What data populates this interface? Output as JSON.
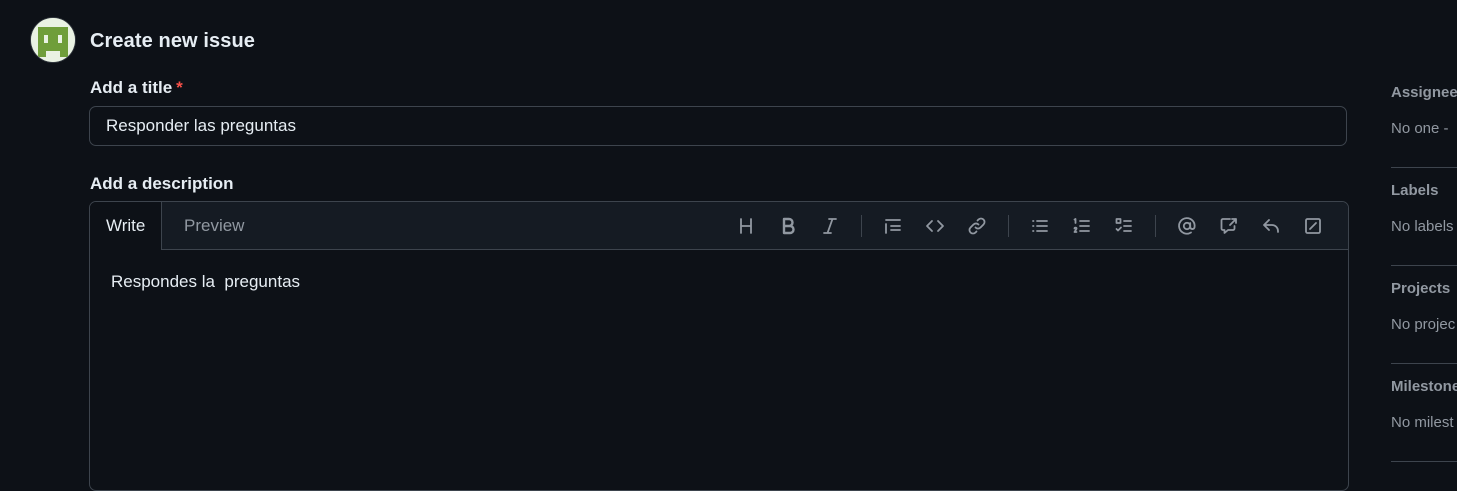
{
  "header": {
    "title": "Create new issue"
  },
  "form": {
    "title_label": "Add a title",
    "required_mark": "*",
    "title_value": "Responder las preguntas",
    "description_label": "Add a description",
    "tabs": {
      "write": "Write",
      "preview": "Preview"
    },
    "toolbar": {
      "buttons": [
        "heading-icon",
        "bold-icon",
        "italic-icon",
        "quote-icon",
        "code-icon",
        "link-icon",
        "unordered-list-icon",
        "ordered-list-icon",
        "task-list-icon",
        "mention-icon",
        "reference-icon",
        "saved-replies-icon",
        "slash-commands-icon"
      ]
    },
    "description_value": "Respondes la  preguntas"
  },
  "sidebar": {
    "sections": [
      {
        "title": "Assignees",
        "value": "No one -"
      },
      {
        "title": "Labels",
        "value": "No labels"
      },
      {
        "title": "Projects",
        "value": "No projec"
      },
      {
        "title": "Milestone",
        "value": "No milest"
      }
    ]
  },
  "colors": {
    "background": "#0d1117",
    "border": "#3d444d",
    "muted": "#9198a1",
    "required": "#f85149",
    "avatar_green": "#6f9e3a"
  }
}
